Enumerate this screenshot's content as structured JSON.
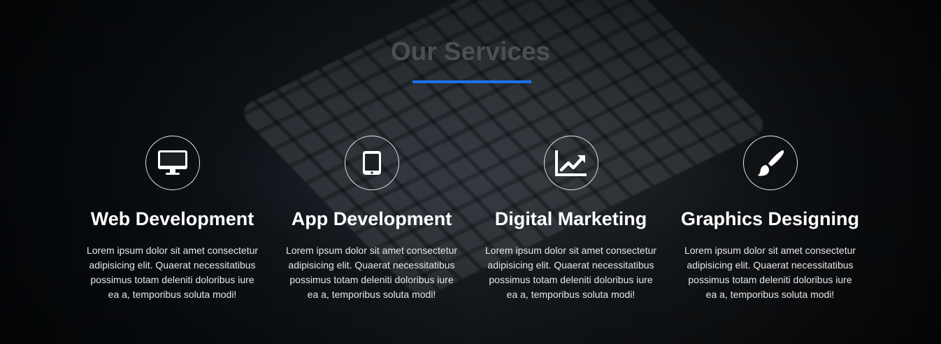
{
  "section": {
    "title": "Our Services",
    "accent_color": "#1a73e8"
  },
  "services": [
    {
      "icon": "desktop-monitor-icon",
      "title": "Web Development",
      "text": "Lorem ipsum dolor sit amet consectetur adipisicing elit. Quaerat necessitatibus possimus totam deleniti doloribus iure ea a, temporibus soluta modi!"
    },
    {
      "icon": "tablet-icon",
      "title": "App Development",
      "text": "Lorem ipsum dolor sit amet consectetur adipisicing elit. Quaerat necessitatibus possimus totam deleniti doloribus iure ea a, temporibus soluta modi!"
    },
    {
      "icon": "chart-line-icon",
      "title": "Digital Marketing",
      "text": "Lorem ipsum dolor sit amet consectetur adipisicing elit. Quaerat necessitatibus possimus totam deleniti doloribus iure ea a, temporibus soluta modi!"
    },
    {
      "icon": "paint-brush-icon",
      "title": "Graphics Designing",
      "text": "Lorem ipsum dolor sit amet consectetur adipisicing elit. Quaerat necessitatibus possimus totam deleniti doloribus iure ea a, temporibus soluta modi!"
    }
  ]
}
